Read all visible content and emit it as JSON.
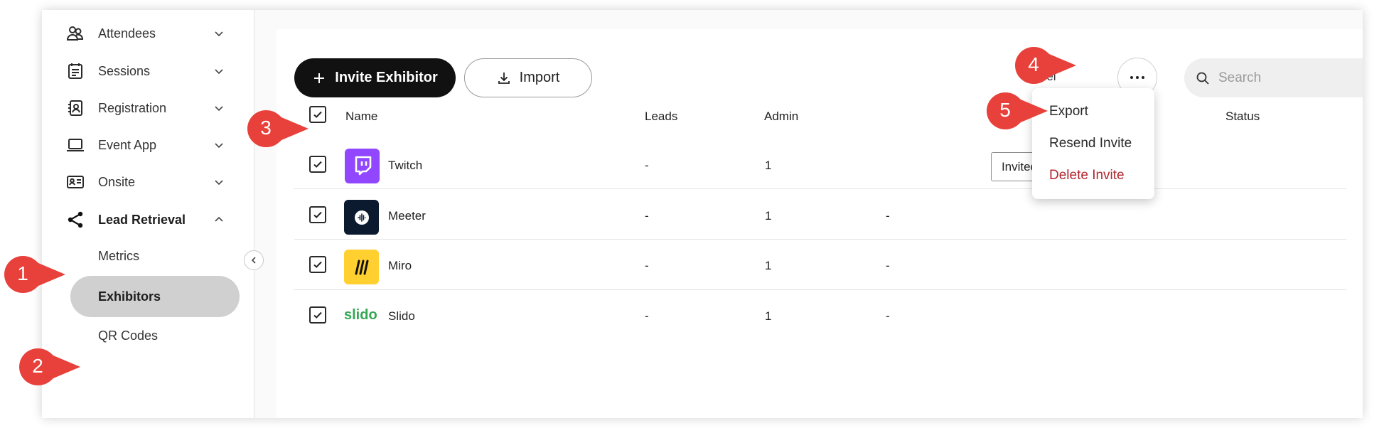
{
  "sidebar": {
    "items": [
      {
        "label": "Attendees",
        "icon": "attendees-icon"
      },
      {
        "label": "Sessions",
        "icon": "sessions-icon"
      },
      {
        "label": "Registration",
        "icon": "registration-icon"
      },
      {
        "label": "Event App",
        "icon": "laptop-icon"
      },
      {
        "label": "Onsite",
        "icon": "badge-card-icon"
      },
      {
        "label": "Lead Retrieval",
        "icon": "share-icon",
        "expanded": true
      }
    ],
    "subitems": [
      {
        "label": "Metrics",
        "active": false
      },
      {
        "label": "Exhibitors",
        "active": true
      },
      {
        "label": "QR Codes",
        "active": false
      }
    ]
  },
  "toolbar": {
    "invite_label": "Invite Exhibitor",
    "import_label": "Import",
    "selected_text": "Sel",
    "search_placeholder": "Search"
  },
  "table": {
    "columns": {
      "name": "Name",
      "leads": "Leads",
      "admin": "Admin",
      "status": "Status"
    },
    "rows": [
      {
        "name": "Twitch",
        "leads": "-",
        "admin": "1",
        "col4": "",
        "status": "Invited",
        "checked": true,
        "logo_color": "#9146ff"
      },
      {
        "name": "Meeter",
        "leads": "-",
        "admin": "1",
        "col4": "-",
        "status": "",
        "checked": true,
        "logo_color": "#0b1a2e"
      },
      {
        "name": "Miro",
        "leads": "-",
        "admin": "1",
        "col4": "-",
        "status": "",
        "checked": true,
        "logo_color": "#ffd02f"
      },
      {
        "name": "Slido",
        "leads": "-",
        "admin": "1",
        "col4": "-",
        "status": "",
        "checked": true,
        "logo_text": "slido",
        "logo_color": "#34a853"
      }
    ]
  },
  "menu": {
    "items": [
      {
        "label": "Export"
      },
      {
        "label": "Resend Invite"
      },
      {
        "label": "Delete Invite",
        "danger": true
      }
    ]
  },
  "callouts": [
    "1",
    "2",
    "3",
    "4",
    "5"
  ],
  "colors": {
    "callout": "#e8403a",
    "accent_dark": "#111111",
    "danger": "#b3262e",
    "active_nav": "#d0d0d0"
  }
}
